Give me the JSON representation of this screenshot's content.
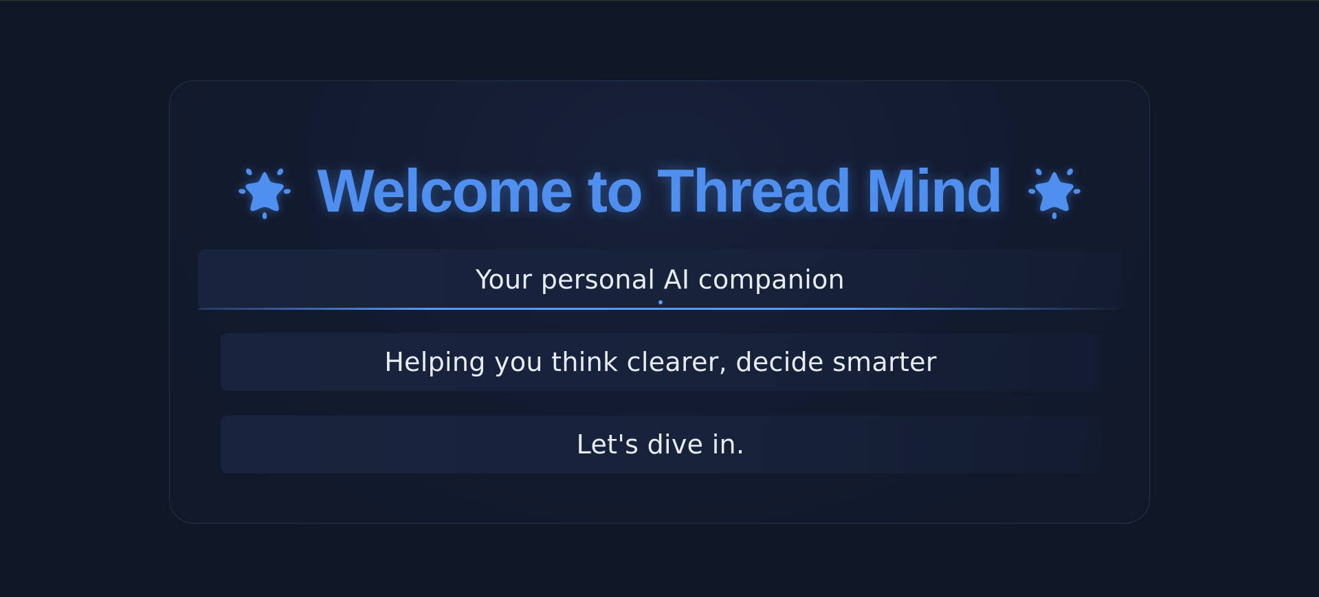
{
  "page": {
    "title": "Welcome to Thread Mind",
    "lines": [
      "Your personal AI companion",
      "Helping you think clearer, decide smarter",
      "Let's dive in."
    ]
  },
  "icons": {
    "left": "sparkle-star-icon",
    "right": "sparkle-star-icon"
  },
  "colors": {
    "background": "#101828",
    "accent": "#4e8ff0",
    "text": "#e8ecf4",
    "card_border": "#26324a"
  }
}
